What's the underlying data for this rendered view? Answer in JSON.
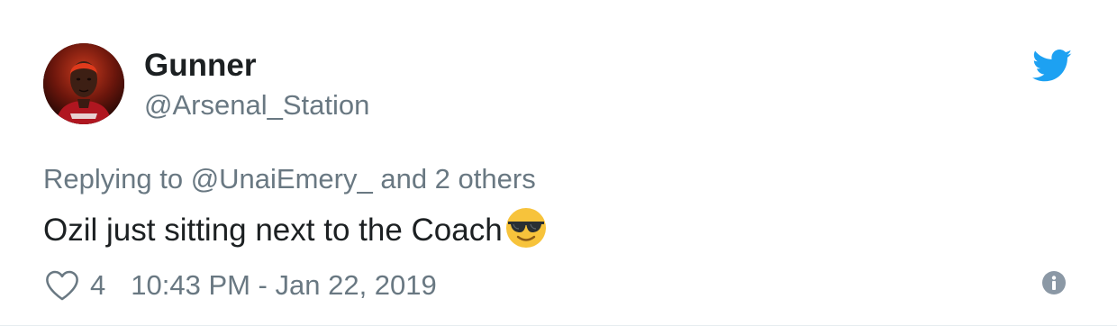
{
  "tweet": {
    "display_name": "Gunner",
    "handle": "@Arsenal_Station",
    "reply_line": "Replying to @UnaiEmery_ and 2 others",
    "text": "Ozil just sitting next to the Coach",
    "emoji": "smiling-face-with-sunglasses",
    "like_count": "4",
    "timestamp": "10:43 PM - Jan 22, 2019"
  },
  "colors": {
    "twitter_blue": "#1da1f2",
    "secondary_text": "#697882",
    "primary_text": "#1c2022",
    "emoji_yellow": "#f7c33b"
  },
  "icons": {
    "brand": "twitter-bird-icon",
    "like": "heart-icon",
    "info": "info-icon"
  }
}
